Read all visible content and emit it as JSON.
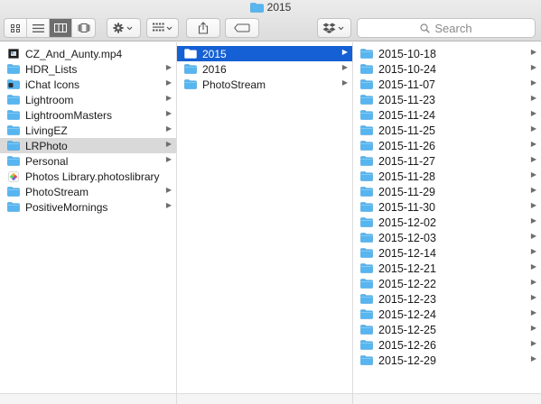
{
  "window": {
    "title": "2015"
  },
  "toolbar": {
    "view_modes": [
      {
        "icon": "icon-view-icon",
        "active": false
      },
      {
        "icon": "list-view-icon",
        "active": false
      },
      {
        "icon": "column-view-icon",
        "active": true
      },
      {
        "icon": "cover-flow-icon",
        "active": false
      }
    ],
    "action_icon": "gear-icon",
    "arrange_icon": "arrange-grid-icon",
    "share_icon": "share-icon",
    "tags_icon": "tag-icon",
    "dropbox_icon": "dropbox-icon",
    "search_placeholder": "Search"
  },
  "colors": {
    "folder": "#57b5f0",
    "selection_active": "#1560d4",
    "selection_inactive": "#d9d9d9"
  },
  "column1": [
    {
      "label": "CZ_And_Aunty.mp4",
      "icon": "video-file-icon",
      "arrow": false,
      "state": ""
    },
    {
      "label": "HDR_Lists",
      "icon": "folder-icon",
      "arrow": true,
      "state": ""
    },
    {
      "label": "iChat Icons",
      "icon": "ichat-folder-icon",
      "arrow": true,
      "state": ""
    },
    {
      "label": "Lightroom",
      "icon": "folder-icon",
      "arrow": true,
      "state": ""
    },
    {
      "label": "LightroomMasters",
      "icon": "folder-icon",
      "arrow": true,
      "state": ""
    },
    {
      "label": "LivingEZ",
      "icon": "folder-icon",
      "arrow": true,
      "state": ""
    },
    {
      "label": "LRPhoto",
      "icon": "folder-icon",
      "arrow": true,
      "state": "gray"
    },
    {
      "label": "Personal",
      "icon": "folder-icon",
      "arrow": true,
      "state": ""
    },
    {
      "label": "Photos Library.photoslibrary",
      "icon": "photos-library-icon",
      "arrow": false,
      "state": ""
    },
    {
      "label": "PhotoStream",
      "icon": "folder-icon",
      "arrow": true,
      "state": ""
    },
    {
      "label": "PositiveMornings",
      "icon": "folder-icon",
      "arrow": true,
      "state": ""
    }
  ],
  "column2": [
    {
      "label": "2015",
      "icon": "folder-icon",
      "arrow": true,
      "state": "blue"
    },
    {
      "label": "2016",
      "icon": "folder-icon",
      "arrow": true,
      "state": ""
    },
    {
      "label": "PhotoStream",
      "icon": "folder-icon",
      "arrow": true,
      "state": ""
    }
  ],
  "column3": [
    {
      "label": "2015-10-18",
      "icon": "folder-icon",
      "arrow": true,
      "state": ""
    },
    {
      "label": "2015-10-24",
      "icon": "folder-icon",
      "arrow": true,
      "state": ""
    },
    {
      "label": "2015-11-07",
      "icon": "folder-icon",
      "arrow": true,
      "state": ""
    },
    {
      "label": "2015-11-23",
      "icon": "folder-icon",
      "arrow": true,
      "state": ""
    },
    {
      "label": "2015-11-24",
      "icon": "folder-icon",
      "arrow": true,
      "state": ""
    },
    {
      "label": "2015-11-25",
      "icon": "folder-icon",
      "arrow": true,
      "state": ""
    },
    {
      "label": "2015-11-26",
      "icon": "folder-icon",
      "arrow": true,
      "state": ""
    },
    {
      "label": "2015-11-27",
      "icon": "folder-icon",
      "arrow": true,
      "state": ""
    },
    {
      "label": "2015-11-28",
      "icon": "folder-icon",
      "arrow": true,
      "state": ""
    },
    {
      "label": "2015-11-29",
      "icon": "folder-icon",
      "arrow": true,
      "state": ""
    },
    {
      "label": "2015-11-30",
      "icon": "folder-icon",
      "arrow": true,
      "state": ""
    },
    {
      "label": "2015-12-02",
      "icon": "folder-icon",
      "arrow": true,
      "state": ""
    },
    {
      "label": "2015-12-03",
      "icon": "folder-icon",
      "arrow": true,
      "state": ""
    },
    {
      "label": "2015-12-14",
      "icon": "folder-icon",
      "arrow": true,
      "state": ""
    },
    {
      "label": "2015-12-21",
      "icon": "folder-icon",
      "arrow": true,
      "state": ""
    },
    {
      "label": "2015-12-22",
      "icon": "folder-icon",
      "arrow": true,
      "state": ""
    },
    {
      "label": "2015-12-23",
      "icon": "folder-icon",
      "arrow": true,
      "state": ""
    },
    {
      "label": "2015-12-24",
      "icon": "folder-icon",
      "arrow": true,
      "state": ""
    },
    {
      "label": "2015-12-25",
      "icon": "folder-icon",
      "arrow": true,
      "state": ""
    },
    {
      "label": "2015-12-26",
      "icon": "folder-icon",
      "arrow": true,
      "state": ""
    },
    {
      "label": "2015-12-29",
      "icon": "folder-icon",
      "arrow": true,
      "state": ""
    }
  ]
}
